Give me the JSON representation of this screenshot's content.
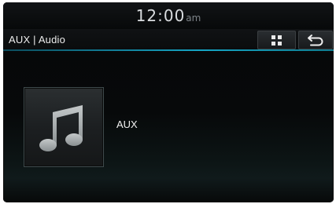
{
  "status_bar": {
    "time": "12:00",
    "ampm": "am"
  },
  "title_bar": {
    "title": "AUX | Audio",
    "menu_icon": "grid-icon",
    "back_icon": "back-arrow-icon"
  },
  "source": {
    "label": "AUX",
    "icon": "music-note-icon"
  },
  "colors": {
    "accent_line": "#15a5c4",
    "text_primary": "#ececec",
    "ampm_text": "#7c8287"
  }
}
